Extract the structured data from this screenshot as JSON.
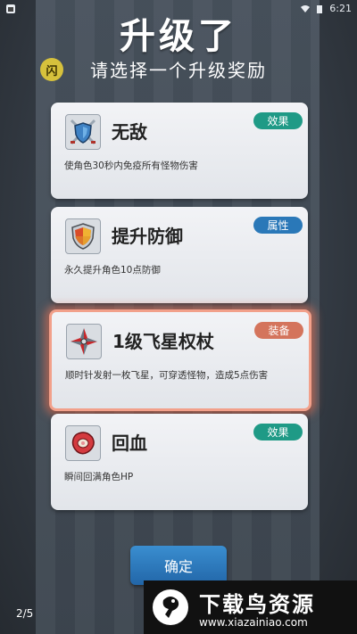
{
  "status": {
    "time": "6:21"
  },
  "header": {
    "title": "升级了",
    "subtitle": "请选择一个升级奖励",
    "badge": "闪"
  },
  "cards": [
    {
      "name": "无敌",
      "desc": "使角色30秒内免疫所有怪物伤害",
      "tag": "效果",
      "tag_color": "#1f9a86",
      "icon": "shield-swords-icon"
    },
    {
      "name": "提升防御",
      "desc": "永久提升角色10点防御",
      "tag": "属性",
      "tag_color": "#2a78b8",
      "icon": "shield-icon"
    },
    {
      "name": "1级飞星权杖",
      "desc": "顺时针发射一枚飞星，可穿透怪物，造成5点伤害",
      "tag": "装备",
      "tag_color": "#d4745c",
      "icon": "shuriken-icon"
    },
    {
      "name": "回血",
      "desc": "瞬间回满角色HP",
      "tag": "效果",
      "tag_color": "#1f9a86",
      "icon": "meat-icon"
    }
  ],
  "confirm_label": "确定",
  "pager": "2/5",
  "watermark": {
    "title": "下载鸟资源",
    "url": "www.xiazainiao.com"
  }
}
